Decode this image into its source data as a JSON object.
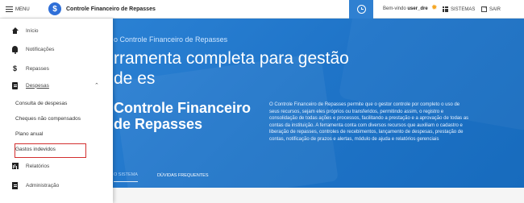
{
  "topbar": {
    "menu_label": "MENU",
    "brand_logo_letter": "$",
    "brand_name": "Controle Financeiro de Repasses",
    "welcome_prefix": "Bem-vindo",
    "username": "user_dre",
    "sistemas_label": "SISTEMAS",
    "sair_label": "SAIR"
  },
  "hero": {
    "subtitle": "o Controle Financeiro de Repasses",
    "title": "rramenta completa para gestão de es",
    "heading": "Controle Financeiro de Repasses",
    "description": "O Controle Financeiro de Repasses permite que o gestor controle por completo o uso de seus recursos, sejam eles próprios ou transferidos, permitindo assim, o registro e consolidação de todas ações e processos, facilitando a prestação e a aprovação de todas as contas da instituição. A ferramenta conta com diversos recursos que auxiliam o cadastro e liberação de repasses, controles de recebimentos, lançamento de despesas, prestação de contas, notificação de prazos e alertas, módulo de ajuda e relatórios gerenciais",
    "tabs": [
      {
        "label": "O SISTEMA"
      },
      {
        "label": "DÚVIDAS FREQUENTES"
      }
    ]
  },
  "sidebar": {
    "items": [
      {
        "label": "Início",
        "icon": "home-icon"
      },
      {
        "label": "Notificações",
        "icon": "bell-icon"
      },
      {
        "label": "Repasses",
        "icon": "dollar-icon"
      },
      {
        "label": "Despesas",
        "icon": "clipboard-icon"
      },
      {
        "label": "Relatórios",
        "icon": "bar-chart-icon"
      },
      {
        "label": "Administração",
        "icon": "document-icon"
      }
    ],
    "despesas_chevron": "⌃",
    "sub_items": [
      {
        "label": "Consulta de despesas"
      },
      {
        "label": "Cheques não compensados"
      },
      {
        "label": "Plano anual"
      },
      {
        "label": "Gastos indevidos"
      }
    ]
  },
  "colors": {
    "accent": "#2f80d1",
    "hero_bg": "#1f74c8",
    "highlight_border": "#d32f2f"
  }
}
